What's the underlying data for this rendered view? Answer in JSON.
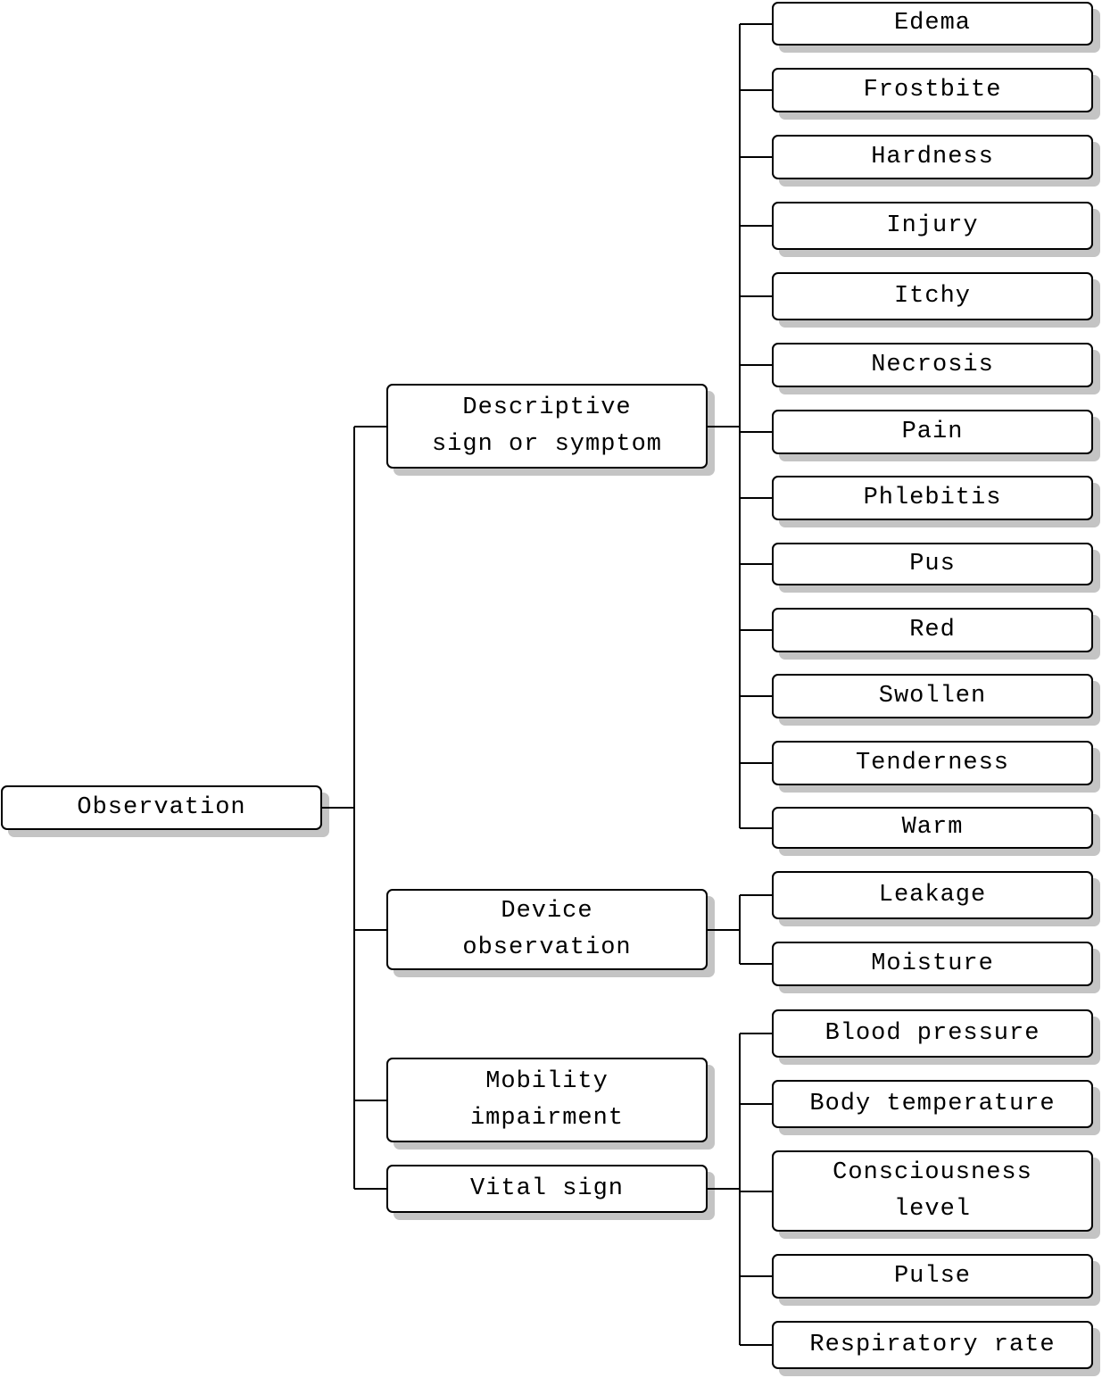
{
  "root": {
    "label": "Observation"
  },
  "categories": [
    {
      "label": "Descriptive\nsign or symptom",
      "children": [
        "Edema",
        "Frostbite",
        "Hardness",
        "Injury",
        "Itchy",
        "Necrosis",
        "Pain",
        "Phlebitis",
        "Pus",
        "Red",
        "Swollen",
        "Tenderness",
        "Warm"
      ]
    },
    {
      "label": "Device\nobservation",
      "children": [
        "Leakage",
        "Moisture"
      ]
    },
    {
      "label": "Mobility\nimpairment",
      "children": []
    },
    {
      "label": "Vital sign",
      "children": [
        "Blood pressure",
        "Body temperature",
        "Consciousness\nlevel",
        "Pulse",
        "Respiratory rate"
      ]
    }
  ]
}
